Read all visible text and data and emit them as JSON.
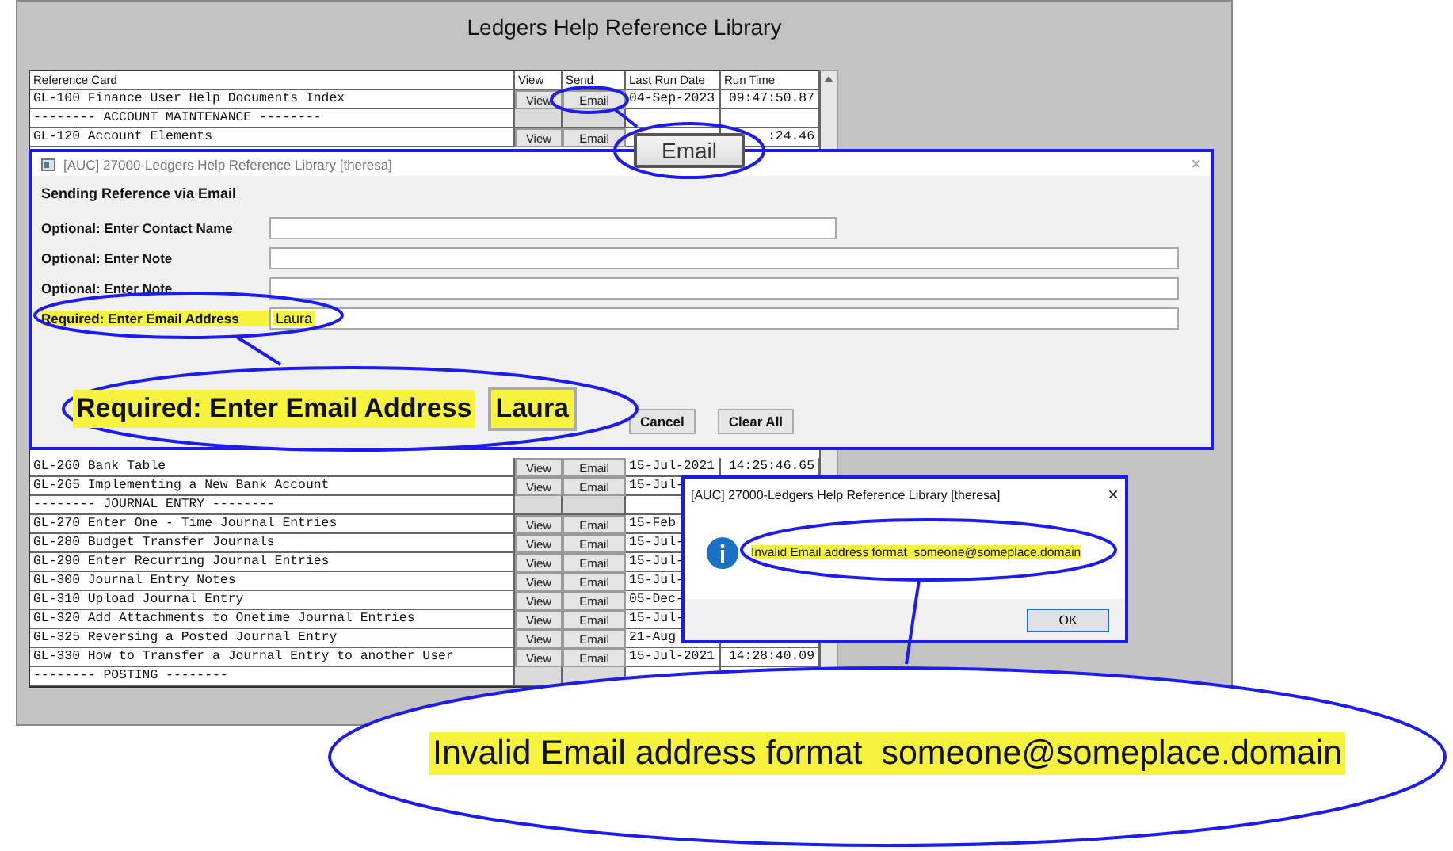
{
  "window": {
    "title": "Ledgers Help Reference Library"
  },
  "table": {
    "columns": [
      "Reference Card",
      "View",
      "Send",
      "Last Run Date",
      "Run Time"
    ],
    "rows_top": [
      {
        "kind": "item",
        "reference": "GL-100 Finance User Help Documents Index",
        "view": "View",
        "send": "Email",
        "last_run_date": "04-Sep-2023",
        "run_time": "09:47:50.87"
      },
      {
        "kind": "section",
        "reference": "-------- ACCOUNT MAINTENANCE --------"
      },
      {
        "kind": "item",
        "reference": "GL-120 Account Elements",
        "view": "View",
        "send": "Email",
        "run_time": ":24.46"
      }
    ],
    "rows_bottom": [
      {
        "kind": "item",
        "reference": "GL-260 Bank Table",
        "view": "View",
        "send": "Email",
        "last_run_date": "15-Jul-2021",
        "run_time": "14:25:46.65"
      },
      {
        "kind": "item",
        "reference": "GL-265 Implementing a New Bank Account",
        "view": "View",
        "send": "Email",
        "last_run_date": "15-Jul-"
      },
      {
        "kind": "section",
        "reference": "-------- JOURNAL ENTRY --------"
      },
      {
        "kind": "item",
        "reference": "GL-270 Enter One - Time Journal Entries",
        "view": "View",
        "send": "Email",
        "last_run_date": "15-Feb"
      },
      {
        "kind": "item",
        "reference": "GL-280 Budget Transfer Journals",
        "view": "View",
        "send": "Email",
        "last_run_date": "15-Jul-"
      },
      {
        "kind": "item",
        "reference": "GL-290 Enter Recurring Journal Entries",
        "view": "View",
        "send": "Email",
        "last_run_date": "15-Jul-"
      },
      {
        "kind": "item",
        "reference": "GL-300 Journal Entry Notes",
        "view": "View",
        "send": "Email",
        "last_run_date": "15-Jul-"
      },
      {
        "kind": "item",
        "reference": "GL-310 Upload Journal Entry",
        "view": "View",
        "send": "Email",
        "last_run_date": "05-Dec-"
      },
      {
        "kind": "item",
        "reference": "GL-320 Add Attachments to Onetime Journal Entries",
        "view": "View",
        "send": "Email",
        "last_run_date": "15-Jul-"
      },
      {
        "kind": "item",
        "reference": "GL-325 Reversing a Posted Journal Entry",
        "view": "View",
        "send": "Email",
        "last_run_date": "21-Aug"
      },
      {
        "kind": "item",
        "reference": "GL-330 How to Transfer a Journal Entry to another User",
        "view": "View",
        "send": "Email",
        "last_run_date": "15-Jul-2021",
        "run_time": "14:28:40.09"
      },
      {
        "kind": "section",
        "reference": "-------- POSTING --------"
      }
    ]
  },
  "email_dialog": {
    "title": "[AUC] 27000-Ledgers Help Reference Library [theresa]",
    "close": "×",
    "heading": "Sending Reference via Email",
    "fields": [
      {
        "label": "Optional: Enter Contact Name",
        "highlighted": false
      },
      {
        "label": "Optional: Enter Note",
        "highlighted": false
      },
      {
        "label": "Optional: Enter Note",
        "highlighted": false
      },
      {
        "label": "Required: Enter Email Address",
        "value": "Laura",
        "highlighted": true
      }
    ],
    "buttons": [
      "Cancel",
      "Clear All"
    ]
  },
  "error_dialog": {
    "title": "[AUC] 27000-Ledgers Help Reference Library [theresa]",
    "close": "×",
    "message": "Invalid Email address format  someone@someplace.domain",
    "button": "OK"
  },
  "callouts": [
    {
      "kind": "button",
      "text": "Email"
    },
    {
      "kind": "field",
      "label": "Required: Enter Email Address",
      "value": "Laura"
    },
    {
      "kind": "message",
      "text": "Invalid Email address format  someone@someplace.domain"
    }
  ]
}
